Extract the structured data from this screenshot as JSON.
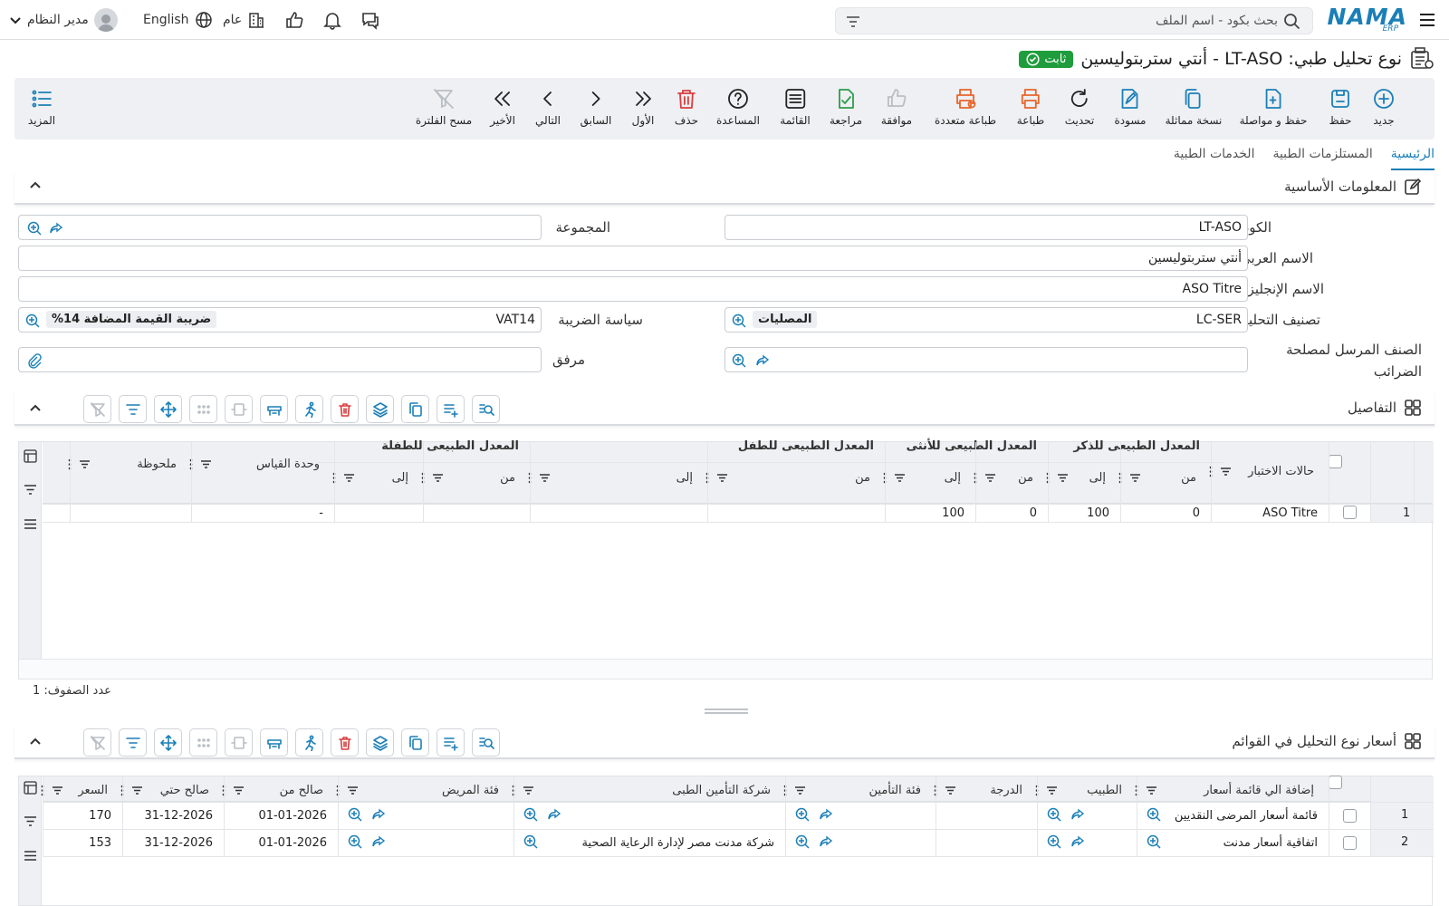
{
  "app": {
    "logo": "NAMA",
    "logo_sub": "ERP"
  },
  "topbar": {
    "search_placeholder": "بحث بكود - اسم الملف",
    "user": "مدير النظام",
    "language": "English",
    "branch": "عام"
  },
  "title": {
    "text": "نوع تحليل طبي: LT-ASO - أنتي ستربتوليسين",
    "status": "ثابت"
  },
  "toolbar": [
    {
      "label": "جديد",
      "icon": "plus-circle-icon",
      "color": "#1b7fb7"
    },
    {
      "label": "حفظ",
      "icon": "save-icon",
      "color": "#1b7fb7"
    },
    {
      "label": "حفظ و مواصلة",
      "icon": "save-continue-icon",
      "color": "#1b7fb7"
    },
    {
      "label": "نسخة مماثلة",
      "icon": "copy-icon",
      "color": "#1b7fb7"
    },
    {
      "label": "مسودة",
      "icon": "draft-icon",
      "color": "#1b7fb7"
    },
    {
      "label": "تحديث",
      "icon": "refresh-icon",
      "color": "#222"
    },
    {
      "label": "طباعة",
      "icon": "print-icon",
      "color": "#e8652b"
    },
    {
      "label": "طباعة متعددة",
      "icon": "multi-print-icon",
      "color": "#e8652b"
    },
    {
      "label": "موافقة",
      "icon": "thumbs-up-icon",
      "color": "#b9bec4"
    },
    {
      "label": "مراجعة",
      "icon": "review-icon",
      "color": "#2e9c4a"
    },
    {
      "label": "القائمة",
      "icon": "list-icon",
      "color": "#222"
    },
    {
      "label": "المساعدة",
      "icon": "help-icon",
      "color": "#222"
    },
    {
      "label": "حذف",
      "icon": "trash-icon",
      "color": "#d93d3d"
    },
    {
      "label": "الأول",
      "icon": "first-icon",
      "color": "#222"
    },
    {
      "label": "السابق",
      "icon": "previous-icon",
      "color": "#222"
    },
    {
      "label": "التالي",
      "icon": "next-icon",
      "color": "#222"
    },
    {
      "label": "الأخير",
      "icon": "last-icon",
      "color": "#222"
    },
    {
      "label": "مسح الفلترة",
      "icon": "clear-filter-icon",
      "color": "#b9bec4"
    },
    {
      "label": "المزيد",
      "icon": "more-icon",
      "color": "#1b7fb7"
    }
  ],
  "tabs": [
    {
      "label": "الرئيسية",
      "active": true
    },
    {
      "label": "المستلزمات الطبية",
      "active": false
    },
    {
      "label": "الخدمات الطبية",
      "active": false
    }
  ],
  "basic": {
    "title": "المعلومات الأساسية",
    "code_label": "الكود",
    "code": "LT-ASO",
    "group_label": "المجموعة",
    "group": "",
    "arabic_label": "الاسم العربي",
    "arabic": "أنتي ستربتوليسين",
    "english_label": "الاسم الإنجليزي",
    "english": "ASO Titre",
    "category_label": "تصنيف التحليل",
    "category_code": "LC-SER",
    "category_name": "المصليات",
    "tax_label": "سياسة الضريبة",
    "tax_code": "VAT14",
    "tax_name": "ضريبة القيمة المضافة 14%",
    "tax_item_label": "الصنف المرسل لمصلحة الضرائب",
    "attachment_label": "مرفق"
  },
  "details": {
    "title": "التفاصيل",
    "group_headers": [
      "المعدل الطبيعى للذكر",
      "المعدل الطبيعى للأنثى",
      "المعدل الطبيعى للطفل",
      "المعدل الطبيعى للطفلة"
    ],
    "columns": {
      "test_case": "حالات الاختبار",
      "from": "من",
      "to": "إلى",
      "unit": "وحدة القياس",
      "note": "ملحوظة"
    },
    "rows": [
      {
        "no": "1",
        "test_case": "ASO Titre",
        "male_from": "0",
        "male_to": "100",
        "female_from": "0",
        "female_to": "100",
        "child_from": "",
        "child_to": "",
        "girl_from": "",
        "girl_to": "",
        "unit": "-",
        "note": ""
      }
    ],
    "row_count": "عدد الصفوف: 1"
  },
  "prices": {
    "title": "أسعار نوع التحليل في القوائم",
    "columns": [
      "إضافة الي قائمة أسعار",
      "الطبيب",
      "الدرجة",
      "فئة التأمين",
      "شركة التأمين الطبى",
      "فئة المريض",
      "صالح من",
      "صالح حتي",
      "السعر"
    ],
    "rows": [
      {
        "no": "1",
        "list": "قائمة أسعار المرضى النقديين",
        "doctor": "",
        "degree": "",
        "ins_cat": "",
        "ins_company": "",
        "patient_cat": "",
        "from": "01-01-2026",
        "to": "31-12-2026",
        "price": "170"
      },
      {
        "no": "2",
        "list": "اتفاقية أسعار مدنت",
        "doctor": "",
        "degree": "",
        "ins_cat": "",
        "ins_company": "شركة مدنت مصر لإدارة الرعاية الصحية",
        "patient_cat": "",
        "from": "01-01-2026",
        "to": "31-12-2026",
        "price": "153"
      }
    ]
  },
  "colors": {
    "accent": "#1b7fb7",
    "success": "#1f9d3d",
    "danger": "#d93d3d",
    "print": "#e8652b"
  }
}
